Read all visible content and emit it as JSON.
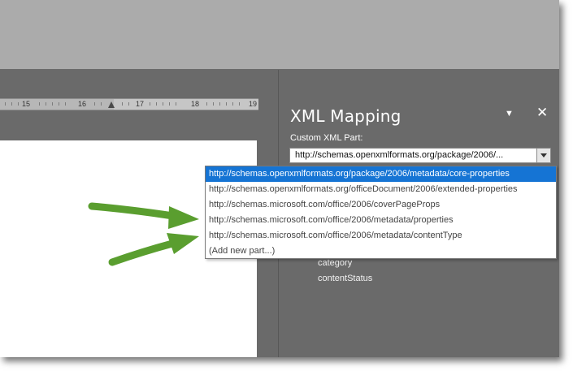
{
  "ruler": {
    "labels": [
      "15",
      "16",
      "17",
      "18",
      "19"
    ]
  },
  "pane": {
    "title": "XML Mapping",
    "menu_glyph": "▼",
    "close_glyph": "✕",
    "field_label": "Custom XML Part:",
    "combo_value": "http://schemas.openxmlformats.org/package/2006/..."
  },
  "dropdown": {
    "items": [
      "http://schemas.openxmlformats.org/package/2006/metadata/core-properties",
      "http://schemas.openxmlformats.org/officeDocument/2006/extended-properties",
      "http://schemas.microsoft.com/office/2006/coverPageProps",
      "http://schemas.microsoft.com/office/2006/metadata/properties",
      "http://schemas.microsoft.com/office/2006/metadata/contentType",
      "(Add new part...)"
    ],
    "selected_index": 0
  },
  "tree": {
    "items": [
      "category",
      "contentStatus"
    ]
  },
  "colors": {
    "selection": "#1574d4",
    "arrow": "#5a9e2f",
    "pane_bg": "#6a6a6a"
  }
}
